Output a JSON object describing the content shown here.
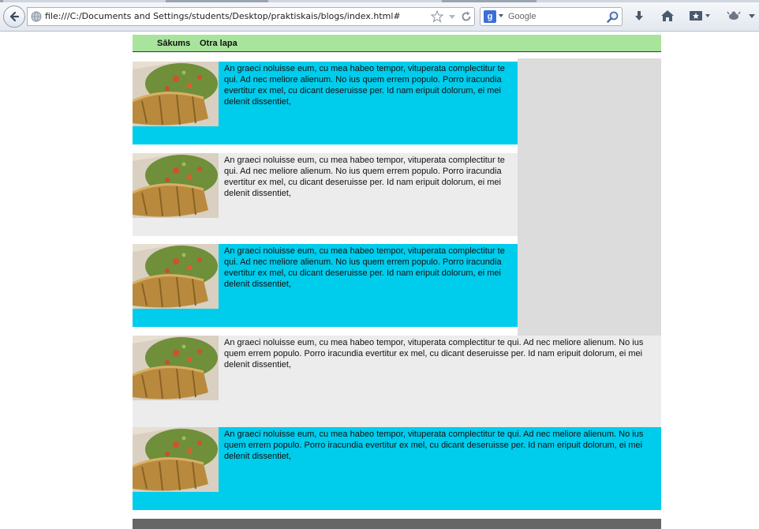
{
  "browser": {
    "url": "file:///C:/Documents and Settings/students/Desktop/praktiskais/blogs/index.html#",
    "search_placeholder": "Google"
  },
  "nav": {
    "home_label": "Sākums",
    "second_label": "Otra lapa"
  },
  "posts": [
    {
      "text": "An graeci noluisse eum, cu mea habeo tempor, vituperata complectitur te qui. Ad nec meliore alienum. No ius quem errem populo. Porro iracundia evertitur ex mel, cu dicant deseruisse per. Id nam eripuit dolorum, ei mei delenit dissentiet,"
    },
    {
      "text": "An graeci noluisse eum, cu mea habeo tempor, vituperata complectitur te qui. Ad nec meliore alienum. No ius quem errem populo. Porro iracundia evertitur ex mel, cu dicant deseruisse per. Id nam eripuit dolorum, ei mei delenit dissentiet,"
    },
    {
      "text": "An graeci noluisse eum, cu mea habeo tempor, vituperata complectitur te qui. Ad nec meliore alienum. No ius quem errem populo. Porro iracundia evertitur ex mel, cu dicant deseruisse per. Id nam eripuit dolorum, ei mei delenit dissentiet,"
    },
    {
      "text": "An graeci noluisse eum, cu mea habeo tempor, vituperata complectitur te qui. Ad nec meliore alienum. No ius quem errem populo. Porro iracundia evertitur ex mel, cu dicant deseruisse per. Id nam eripuit dolorum, ei mei delenit dissentiet,"
    },
    {
      "text": "An graeci noluisse eum, cu mea habeo tempor, vituperata complectitur te qui. Ad nec meliore alienum. No ius quem errem populo. Porro iracundia evertitur ex mel, cu dicant deseruisse per. Id nam eripuit dolorum, ei mei delenit dissentiet,"
    }
  ],
  "colors": {
    "nav_bg": "#a8e49c",
    "cyan_post": "#00ccec",
    "grey_post": "#ececec",
    "sidebar": "#dcdcdc",
    "footer": "#666666"
  },
  "icons": {
    "back": "back-arrow-icon",
    "globe": "globe-icon",
    "bookmark_star": "star-icon",
    "history_drop": "chevron-down-icon",
    "reload": "reload-icon",
    "search_engine": "google-icon",
    "search": "magnifier-icon",
    "download": "download-icon",
    "home": "home-icon",
    "bookmarks": "bookmarks-icon",
    "addon": "addon-icon"
  }
}
